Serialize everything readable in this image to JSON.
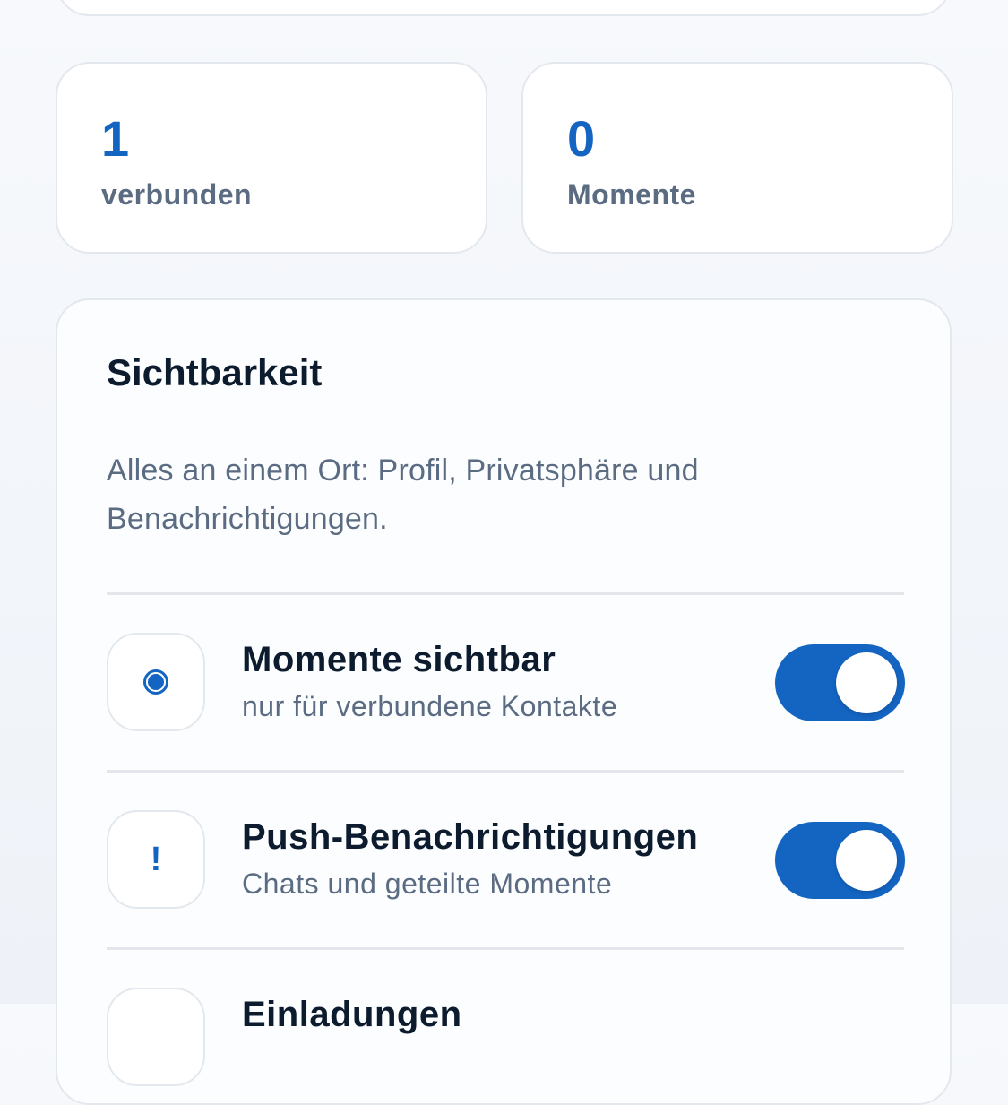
{
  "stats": [
    {
      "value": "1",
      "label": "verbunden"
    },
    {
      "value": "0",
      "label": "Momente"
    }
  ],
  "visibility": {
    "title": "Sichtbarkeit",
    "description": "Alles an einem Ort: Profil, Privatsphäre und Benachrichtigungen.",
    "rows": [
      {
        "title": "Momente sichtbar",
        "subtitle": "nur für verbundene Kontakte",
        "icon": "radio-icon",
        "enabled": true
      },
      {
        "title": "Push-Benachrichtigungen",
        "subtitle": "Chats und geteilte Momente",
        "icon": "exclamation-icon",
        "enabled": true
      },
      {
        "title": "Einladungen",
        "subtitle": "",
        "icon": "",
        "enabled": null
      }
    ]
  },
  "colors": {
    "accent": "#1464c2",
    "text_primary": "#0d1b2e",
    "text_secondary": "#5a6b82",
    "border": "#e3e8ef"
  }
}
